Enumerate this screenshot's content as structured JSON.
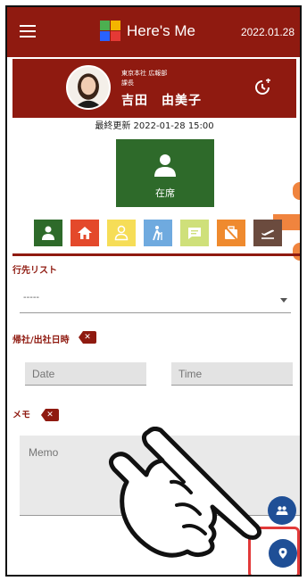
{
  "app": {
    "title": "Here's Me",
    "date": "2022.01.28"
  },
  "profile": {
    "department": "東京本社 広報部",
    "role": "課長",
    "name": "吉田　由美子",
    "last_updated": "最終更新 2022-01-28 15:00"
  },
  "current_status": {
    "label": "在席",
    "icon": "person-icon",
    "color": "#2e6a2a"
  },
  "status_buttons": [
    {
      "name": "present",
      "icon": "person-icon",
      "color": "#2e6a2a"
    },
    {
      "name": "home",
      "icon": "home-icon",
      "color": "#e4492b"
    },
    {
      "name": "person-outline",
      "icon": "person-outline-icon",
      "color": "#f6dd57"
    },
    {
      "name": "walking",
      "icon": "walking-icon",
      "color": "#6faadf"
    },
    {
      "name": "chat",
      "icon": "chat-icon",
      "color": "#cfe07a"
    },
    {
      "name": "off",
      "icon": "work-off-icon",
      "color": "#ef8a2e"
    },
    {
      "name": "departure",
      "icon": "flight-takeoff-icon",
      "color": "#6b4b3e"
    }
  ],
  "form": {
    "destination_label": "行先リスト",
    "destination_value": "-----",
    "return_label": "帰社/出社日時",
    "date_placeholder": "Date",
    "time_placeholder": "Time",
    "memo_label": "メモ",
    "memo_placeholder": "Memo"
  },
  "fabs": [
    {
      "name": "group",
      "icon": "group-icon"
    },
    {
      "name": "location",
      "icon": "location-pin-icon"
    }
  ],
  "colors": {
    "brand": "#8f1a10",
    "fab": "#1f4f96",
    "highlight": "#e23a3a",
    "accent_orange": "#f0843e"
  }
}
